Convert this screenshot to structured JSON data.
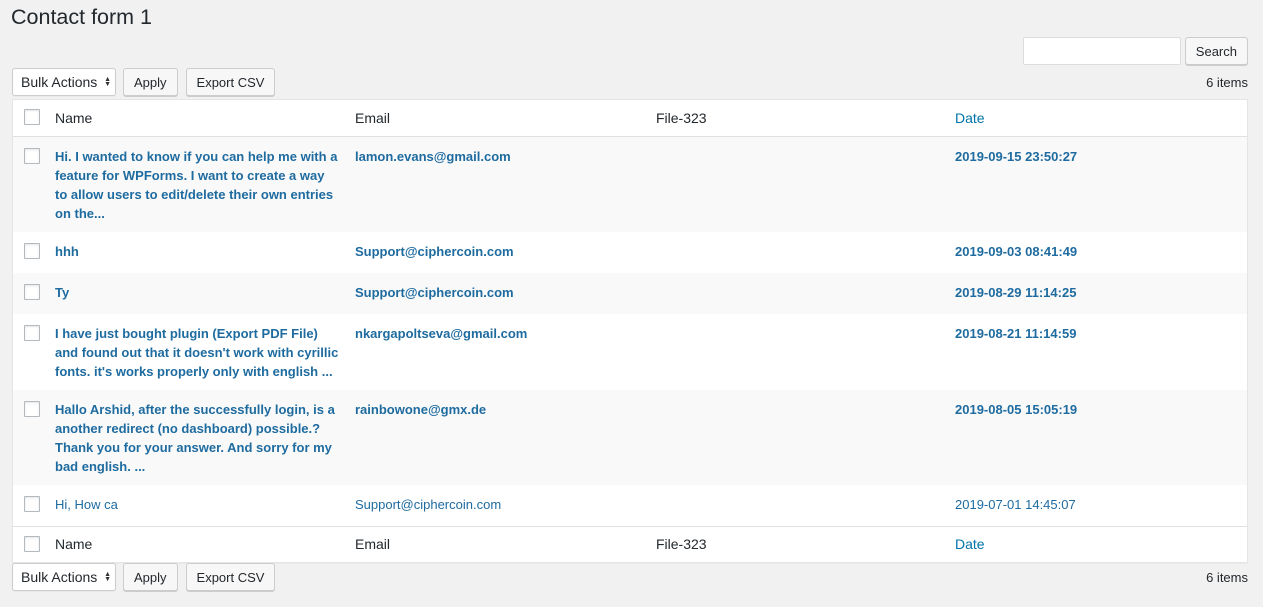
{
  "page": {
    "title": "Contact form 1"
  },
  "search": {
    "value": "",
    "placeholder": "",
    "button_label": "Search"
  },
  "tablenav_top": {
    "bulk_actions": "Bulk Actions",
    "apply_label": "Apply",
    "export_label": "Export CSV",
    "items_count": "6 items"
  },
  "tablenav_bottom": {
    "bulk_actions": "Bulk Actions",
    "apply_label": "Apply",
    "export_label": "Export CSV",
    "items_count": "6 items"
  },
  "table": {
    "columns": {
      "name": "Name",
      "email": "Email",
      "file": "File-323",
      "date": "Date"
    },
    "rows": [
      {
        "name": "Hi. I wanted to know if you can help me with a feature for WPForms. I want to create a way to allow users to edit/delete their own entries on the...",
        "email": "lamon.evans@gmail.com",
        "file": "",
        "date": "2019-09-15 23:50:27",
        "unread": true
      },
      {
        "name": "hhh",
        "email": "Support@ciphercoin.com",
        "file": "",
        "date": "2019-09-03 08:41:49",
        "unread": true
      },
      {
        "name": "Ty",
        "email": "Support@ciphercoin.com",
        "file": "",
        "date": "2019-08-29 11:14:25",
        "unread": true
      },
      {
        "name": "I have just bought plugin (Export PDF File) and found out that it doesn't work with cyrillic fonts. it's works properly only with english ...",
        "email": "nkargapoltseva@gmail.com",
        "file": "",
        "date": "2019-08-21 11:14:59",
        "unread": true
      },
      {
        "name": "Hallo Arshid, after the successfully login, is a another redirect (no dashboard) possible.? Thank you for your answer. And sorry for my bad english. ...",
        "email": "rainbowone@gmx.de",
        "file": "",
        "date": "2019-08-05 15:05:19",
        "unread": true
      },
      {
        "name": "Hi, How ca",
        "email": "Support@ciphercoin.com",
        "file": "",
        "date": "2019-07-01 14:45:07",
        "unread": false
      }
    ]
  },
  "colors": {
    "link": "#1e6ba0",
    "sort_link": "#0073aa",
    "background": "#f1f1f1",
    "alt_row": "#f9f9f9"
  }
}
